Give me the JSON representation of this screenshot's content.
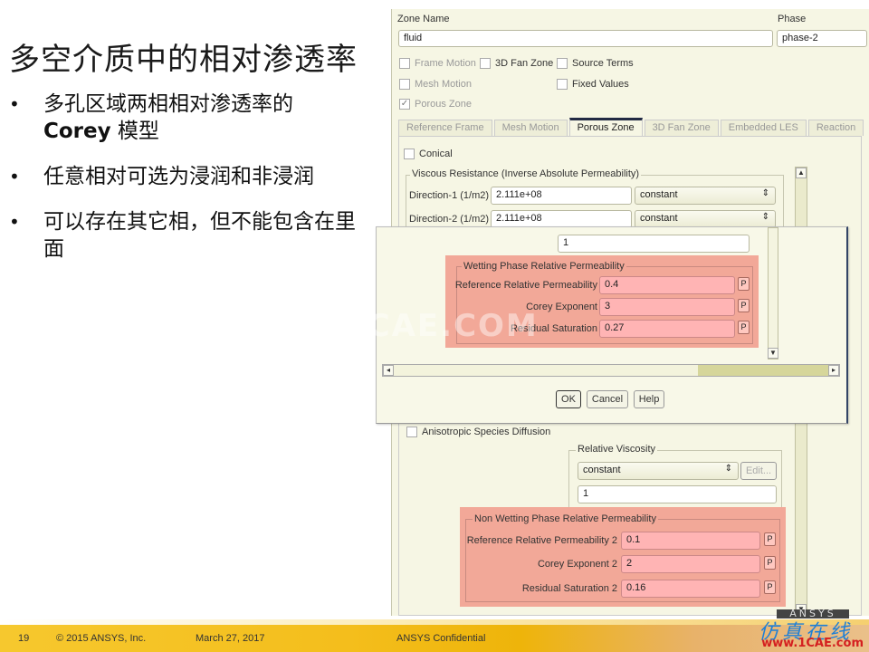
{
  "slide": {
    "title": "多空介质中的相对渗透率",
    "bullets": [
      {
        "text_cn": "多孔区域两相相对渗透率的",
        "text_bold": "Corey",
        "text_tail": " 模型"
      },
      {
        "text": "任意相对可选为浸润和非浸润"
      },
      {
        "text": "可以存在其它相，但不能包含在里面"
      }
    ],
    "bullet_glyph": "•"
  },
  "dialog": {
    "zone_name_label": "Zone Name",
    "zone_name_value": "fluid",
    "phase_label": "Phase",
    "phase_value": "phase-2",
    "checkboxes": {
      "frame_motion": {
        "label": "Frame Motion",
        "checked": false,
        "enabled": false
      },
      "fan_zone_3d": {
        "label": "3D Fan Zone",
        "checked": false,
        "enabled": true
      },
      "source_terms": {
        "label": "Source Terms",
        "checked": false,
        "enabled": true
      },
      "mesh_motion": {
        "label": "Mesh Motion",
        "checked": false,
        "enabled": false
      },
      "fixed_values": {
        "label": "Fixed Values",
        "checked": false,
        "enabled": true
      },
      "porous_zone": {
        "label": "Porous Zone",
        "checked": true,
        "enabled": false
      }
    },
    "tabs": [
      {
        "label": "Reference Frame",
        "active": false
      },
      {
        "label": "Mesh Motion",
        "active": false
      },
      {
        "label": "Porous Zone",
        "active": true
      },
      {
        "label": "3D Fan Zone",
        "active": false
      },
      {
        "label": "Embedded LES",
        "active": false
      },
      {
        "label": "Reaction",
        "active": false
      }
    ],
    "conical_label": "Conical",
    "viscous_title": "Viscous Resistance (Inverse Absolute Permeability)",
    "direction1_label": "Direction-1 (1/m2)",
    "direction1_value": "2.111e+08",
    "direction1_method": "constant",
    "direction2_label": "Direction-2 (1/m2)",
    "direction2_value": "2.111e+08",
    "direction2_method": "constant",
    "overlay_value": "1",
    "wetting": {
      "title": "Wetting Phase Relative Permeability",
      "rows": [
        {
          "label": "Reference Relative Permeability",
          "value": "0.4",
          "p": "P"
        },
        {
          "label": "Corey Exponent",
          "value": "3",
          "p": "P"
        },
        {
          "label": "Residual Saturation",
          "value": "0.27",
          "p": "P"
        }
      ]
    },
    "buttons": {
      "ok": "OK",
      "cancel": "Cancel",
      "help": "Help"
    },
    "anisotropic_label": "Anisotropic Species Diffusion",
    "relative_viscosity": {
      "title": "Relative Viscosity",
      "method": "constant",
      "edit_label": "Edit...",
      "value": "1"
    },
    "non_wetting": {
      "title": "Non Wetting Phase Relative Permeability",
      "rows": [
        {
          "label": "Reference Relative Permeability 2",
          "value": "0.1",
          "p": "P"
        },
        {
          "label": "Corey Exponent 2",
          "value": "2",
          "p": "P"
        },
        {
          "label": "Residual Saturation 2",
          "value": "0.16",
          "p": "P"
        }
      ]
    }
  },
  "watermark": "1CAE.COM",
  "footer": {
    "page_number": "19",
    "copyright": "© 2015 ANSYS, Inc.",
    "date": "March 27, 2017",
    "confidential": "ANSYS Confidential",
    "brand_mark": "ANSYS",
    "site_cn": "仿真在线",
    "site_url": "www.1CAE.com"
  },
  "colors": {
    "highlight_pink": "#f2a898",
    "field_pink": "#ffb4b4",
    "dialog_bg": "#f6f6e4",
    "footer_yellow": "#f4be1c",
    "site_blue": "#1e7fd6",
    "site_red": "#d42020"
  }
}
